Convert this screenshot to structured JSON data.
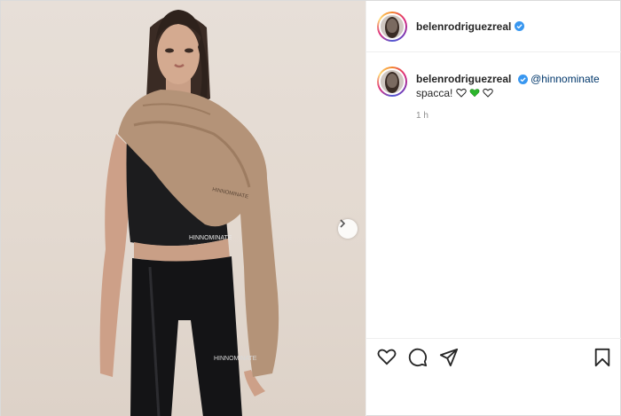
{
  "post": {
    "username": "belenrodriguezreal",
    "comment": {
      "username": "belenrodriguezreal",
      "mention": "@hinnominate",
      "text": "spacca!",
      "time": "1 h"
    },
    "photo_brand_top": "HINNOMINATE",
    "photo_brand_leggings": "HINNOMINATE"
  },
  "colors": {
    "verified": "#3897f0",
    "green_heart": "#2bb52b",
    "mention": "#00376b",
    "time": "#8e8e8e"
  },
  "icons": [
    "chevron-right-icon",
    "verified-icon",
    "heart-icon",
    "comment-icon",
    "share-icon",
    "bookmark-icon",
    "white-heart-icon",
    "green-heart-icon"
  ]
}
